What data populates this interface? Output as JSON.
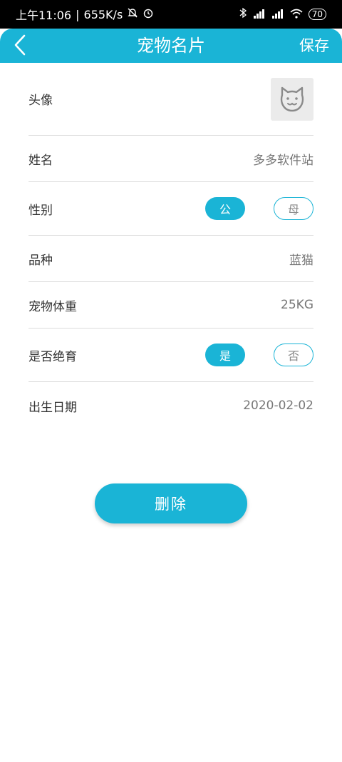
{
  "status_bar": {
    "time": "上午11:06",
    "speed": "655K/s",
    "battery": "70"
  },
  "header": {
    "title": "宠物名片",
    "save_label": "保存"
  },
  "fields": {
    "avatar_label": "头像",
    "name_label": "姓名",
    "name_value": "多多软件站",
    "gender_label": "性别",
    "gender_male": "公",
    "gender_female": "母",
    "breed_label": "品种",
    "breed_value": "蓝猫",
    "weight_label": "宠物体重",
    "weight_value": "25KG",
    "neutered_label": "是否绝育",
    "neutered_yes": "是",
    "neutered_no": "否",
    "birth_label": "出生日期",
    "birth_value": "2020-02-02"
  },
  "actions": {
    "delete_label": "删除"
  },
  "colors": {
    "accent": "#1ab4d6"
  }
}
